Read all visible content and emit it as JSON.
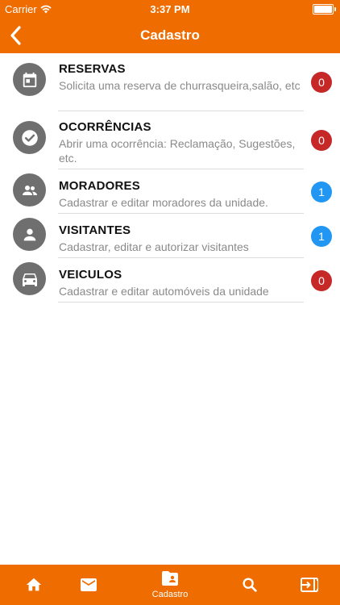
{
  "status": {
    "carrier": "Carrier",
    "time": "3:37 PM"
  },
  "nav": {
    "title": "Cadastro",
    "back_icon": "chevron-left-icon"
  },
  "colors": {
    "primary": "#ef6c00",
    "icon_bg": "#6f6f6f",
    "badge_red": "#c62828",
    "badge_blue": "#2196f3"
  },
  "items": [
    {
      "title": "RESERVAS",
      "desc": "Solicita uma reserva de churrasqueira,salão, etc",
      "count": "0",
      "badge_color": "#c62828",
      "icon": "calendar-icon"
    },
    {
      "title": "OCORRÊNCIAS",
      "desc": "Abrir uma ocorrência: Reclamação, Sugestões, etc.",
      "count": "0",
      "badge_color": "#c62828",
      "icon": "check-circle-icon"
    },
    {
      "title": "MORADORES",
      "desc": "Cadastrar e editar moradores da unidade.",
      "count": "1",
      "badge_color": "#2196f3",
      "icon": "people-icon"
    },
    {
      "title": "VISITANTES",
      "desc": "Cadastrar, editar e autorizar visitantes",
      "count": "1",
      "badge_color": "#2196f3",
      "icon": "person-icon"
    },
    {
      "title": "VEICULOS",
      "desc": "Cadastrar e editar automóveis da unidade",
      "count": "0",
      "badge_color": "#c62828",
      "icon": "car-icon"
    }
  ],
  "tabs": [
    {
      "label": "",
      "icon": "home-icon"
    },
    {
      "label": "",
      "icon": "mail-icon"
    },
    {
      "label": "Cadastro",
      "icon": "folder-person-icon"
    },
    {
      "label": "",
      "icon": "search-icon"
    },
    {
      "label": "",
      "icon": "logout-icon"
    }
  ]
}
